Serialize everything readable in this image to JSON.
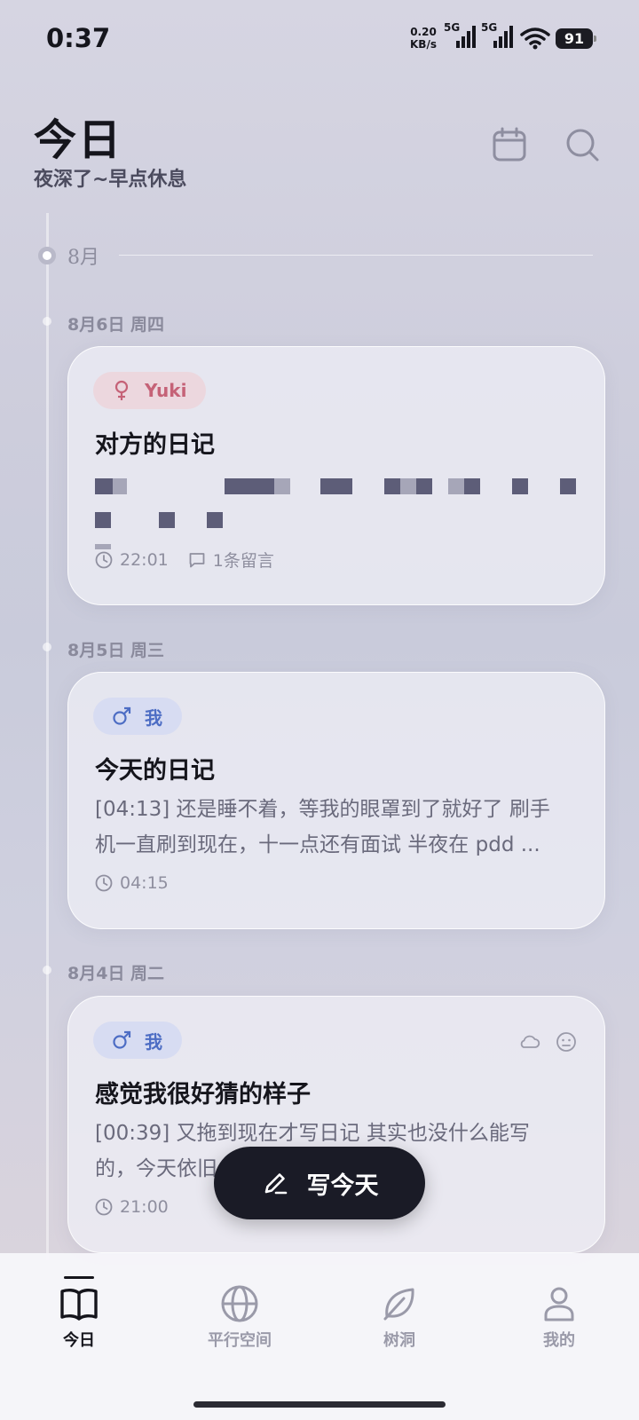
{
  "status_bar": {
    "time": "0:37",
    "net_speed_value": "0.20",
    "net_speed_unit": "KB/s",
    "sig1_label": "5G",
    "sig2_label": "5G",
    "battery": "91"
  },
  "header": {
    "title": "今日",
    "subtitle": "夜深了~早点休息",
    "calendar_icon": "calendar-icon",
    "search_icon": "search-icon"
  },
  "timeline": {
    "month_label": "8月",
    "days": [
      {
        "date_label": "8月6日 周四",
        "entry": {
          "author_tag": "Yuki",
          "author_gender": "female",
          "title": "对方的日记",
          "time": "22:01",
          "comments": "1条留言"
        }
      },
      {
        "date_label": "8月5日 周三",
        "entry": {
          "author_tag": "我",
          "author_gender": "male",
          "title": "今天的日记",
          "preview_line1": "[04:13] 还是睡不着，等我的眼罩到了就好了 刷手",
          "preview_line2": "机一直刷到现在，十一点还有面试 半夜在 pdd ...",
          "time": "04:15"
        }
      },
      {
        "date_label": "8月4日 周二",
        "entry": {
          "author_tag": "我",
          "author_gender": "male",
          "title": "感觉我很好猜的样子",
          "preview_line1": "[00:39] 又拖到现在才写日记 其实也没什么能写",
          "preview_line2": "的，今天依旧   前天周日的时...",
          "time": "21:00",
          "weather_icon": "cloud-icon",
          "mood_icon": "neutral-face-icon"
        }
      }
    ]
  },
  "fab": {
    "label": "写今天",
    "icon": "pen-icon"
  },
  "tabbar": {
    "tabs": [
      {
        "label": "今日",
        "icon": "book-icon",
        "active": true
      },
      {
        "label": "平行空间",
        "icon": "globe-icon",
        "active": false
      },
      {
        "label": "树洞",
        "icon": "leaf-icon",
        "active": false
      },
      {
        "label": "我的",
        "icon": "user-icon",
        "active": false
      }
    ]
  },
  "colors": {
    "accent_dark": "#1a1b26",
    "female_tag": "#c56277",
    "male_tag": "#4d6dc4"
  }
}
